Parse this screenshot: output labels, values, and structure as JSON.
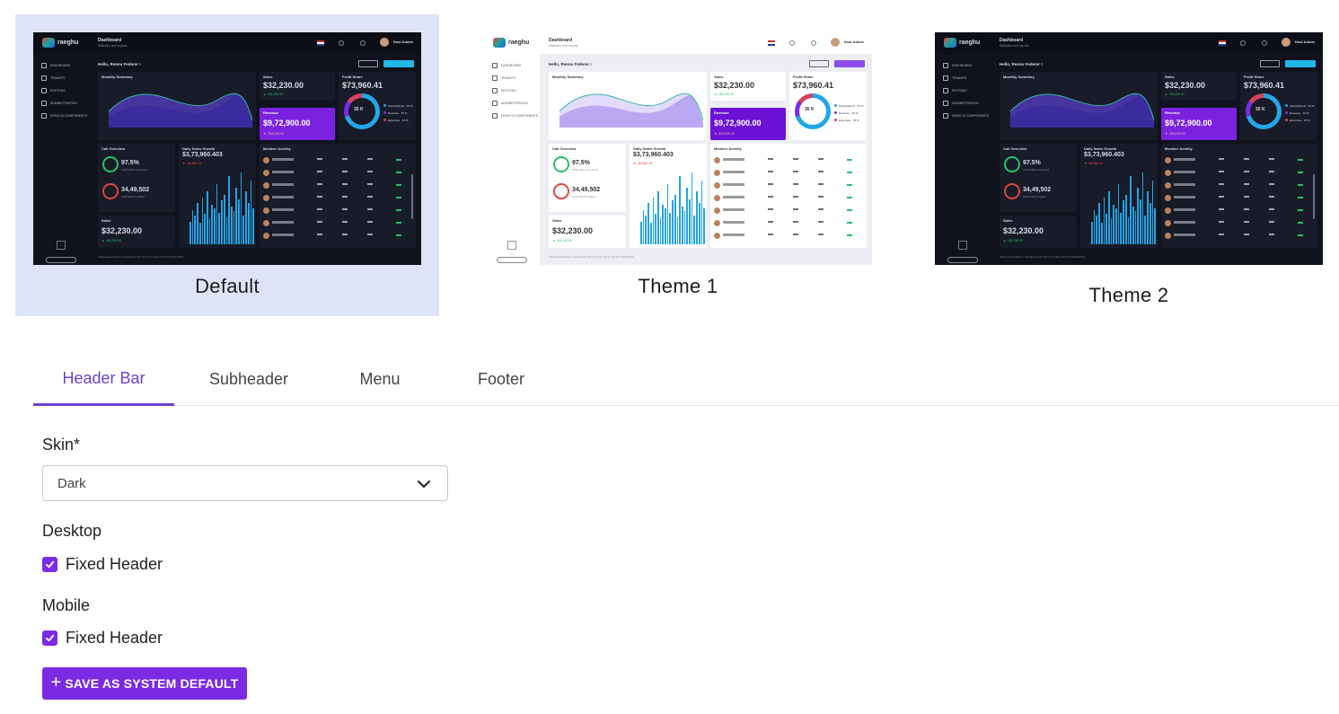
{
  "themes": [
    {
      "name": "Default",
      "selected": true,
      "variant": "dark"
    },
    {
      "name": "Theme 1",
      "selected": false,
      "variant": "light"
    },
    {
      "name": "Theme 2",
      "selected": false,
      "variant": "dark"
    }
  ],
  "preview": {
    "brand": "raeghu",
    "page_title": "Dashboard",
    "page_subtitle": "Statistics and reports",
    "user": "Host Admin",
    "greeting": "Hello, Reenu Federer !",
    "side_items": [
      "DASHBOARD",
      "TENANTS",
      "EDITIONS",
      "ADMINISTRATION",
      "DEMO UI COMPONENTS"
    ],
    "monthly_summary": "Monthly Summary",
    "sales_label": "Sales",
    "sales_value": "$32,230.00",
    "sales_change": "▲ +$2,230.00",
    "revenue_label": "Revenue",
    "revenue_value": "$9,72,900.00",
    "revenue_change": "▼ -$18,200.00",
    "profit_label": "Profit Share",
    "profit_value": "$73,960.41",
    "profit_center": "35 K",
    "profit_legend": [
      "Subscriptions · 33 %",
      "Revenue · 15 %",
      "Expenses · 15 %"
    ],
    "call_overview": "Call Overview",
    "call_pct": "97.5%",
    "call_pct_sub": "Total Calls Connected",
    "call_count": "34,49,502",
    "call_count_sub": "Total Clients Called",
    "daily_growth": "Daily Sales Growth",
    "daily_value": "$3,73,960.403",
    "daily_change": "▼ -$3,560.15",
    "member_activity": "Member Activity",
    "bottom_sales_label": "Sales",
    "bottom_sales_value": "$32,230.00",
    "bottom_sales_change": "▲ +$2,230.00",
    "footer": "nbDangularASDemo Standard | API v10.0.0 | Client v10.0.0 [20231010]"
  },
  "tabs": [
    "Header Bar",
    "Subheader",
    "Menu",
    "Footer"
  ],
  "active_tab": "Header Bar",
  "form": {
    "skin_label": "Skin*",
    "skin_value": "Dark",
    "desktop_label": "Desktop",
    "desktop_fixed_label": "Fixed Header",
    "desktop_fixed_checked": true,
    "mobile_label": "Mobile",
    "mobile_fixed_label": "Fixed Header",
    "mobile_fixed_checked": true,
    "save_label": "SAVE AS SYSTEM DEFAULT"
  },
  "colors": {
    "accent": "#7b2be3",
    "tab_active": "#6b3fd6",
    "selected_card": "#dfe3f6"
  }
}
